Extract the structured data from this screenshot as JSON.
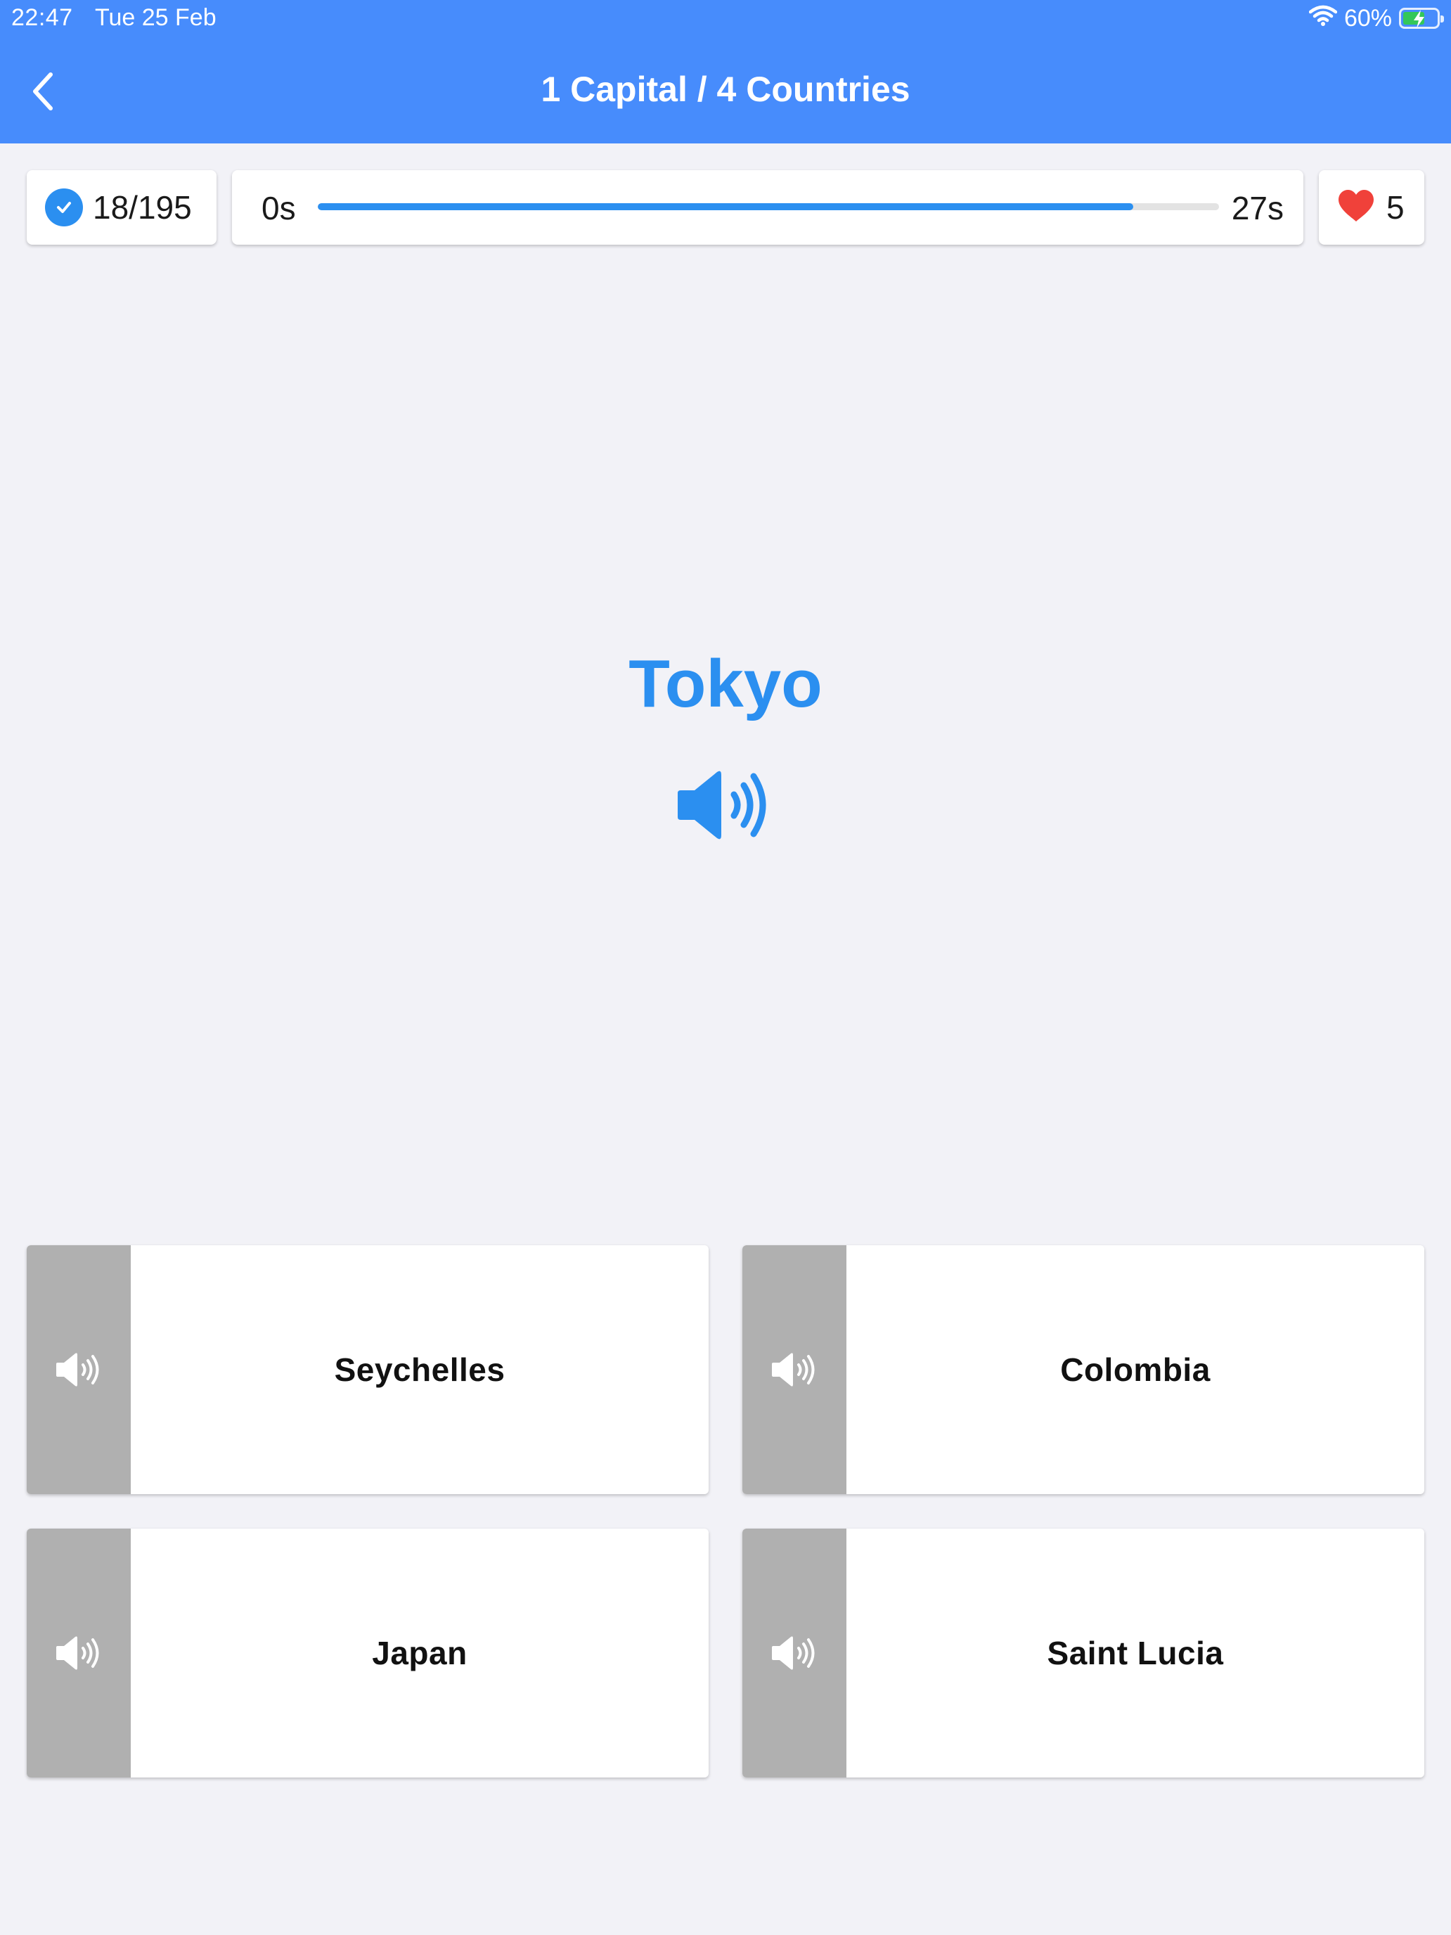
{
  "status_bar": {
    "time": "22:47",
    "date": "Tue 25 Feb",
    "battery": "60%"
  },
  "nav": {
    "title": "1 Capital / 4 Countries",
    "back_icon": "chevron-left-icon"
  },
  "stats": {
    "score": "18/195",
    "timer_start": "0s",
    "timer_end": "27s",
    "timer_progress_fraction": 0.905,
    "lives": "5"
  },
  "question": {
    "capital": "Tokyo",
    "speaker_icon": "speaker-icon"
  },
  "answers": [
    {
      "label": "Seychelles"
    },
    {
      "label": "Colombia"
    },
    {
      "label": "Japan"
    },
    {
      "label": "Saint Lucia"
    }
  ],
  "colors": {
    "header": "#478cfc",
    "accent": "#2b8ff0",
    "heart": "#f0413a",
    "speaker_panel": "#b0b0b0",
    "battery_charge": "#34c759",
    "background": "#f2f2f7"
  }
}
